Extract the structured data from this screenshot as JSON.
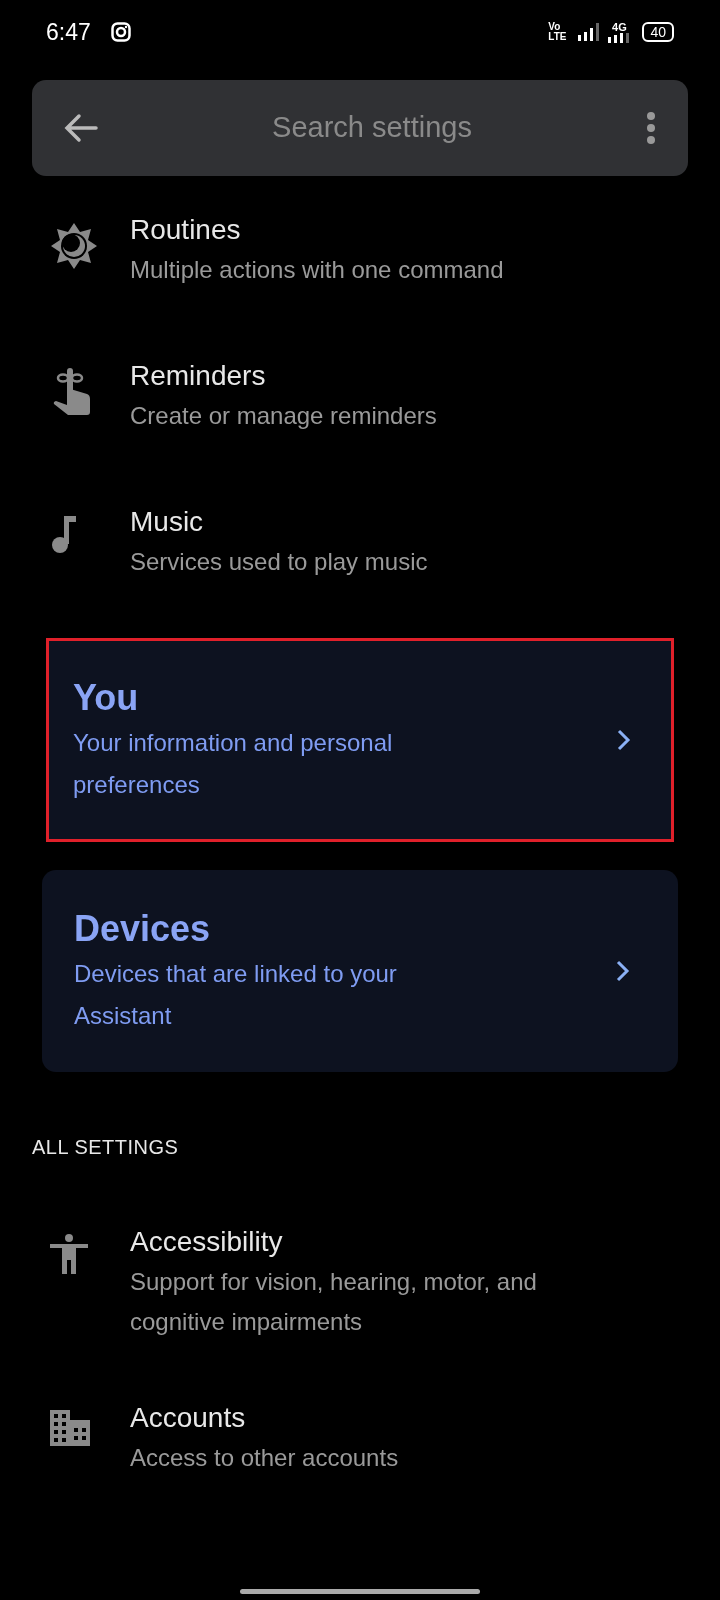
{
  "status_bar": {
    "time": "6:47",
    "volte": [
      "Vo",
      "LTE"
    ],
    "network": "4G",
    "battery": "40"
  },
  "search": {
    "placeholder": "Search settings"
  },
  "items": [
    {
      "title": "Routines",
      "subtitle": "Multiple actions with one command"
    },
    {
      "title": "Reminders",
      "subtitle": "Create or manage reminders"
    },
    {
      "title": "Music",
      "subtitle": "Services used to play music"
    }
  ],
  "cards": [
    {
      "title": "You",
      "subtitle": "Your information and personal preferences",
      "highlighted": true
    },
    {
      "title": "Devices",
      "subtitle": "Devices that are linked to your Assistant",
      "highlighted": false
    }
  ],
  "section_header": "ALL SETTINGS",
  "all_settings": [
    {
      "title": "Accessibility",
      "subtitle": "Support for vision, hearing, motor, and cognitive impairments"
    },
    {
      "title": "Accounts",
      "subtitle": "Access to other accounts"
    }
  ]
}
